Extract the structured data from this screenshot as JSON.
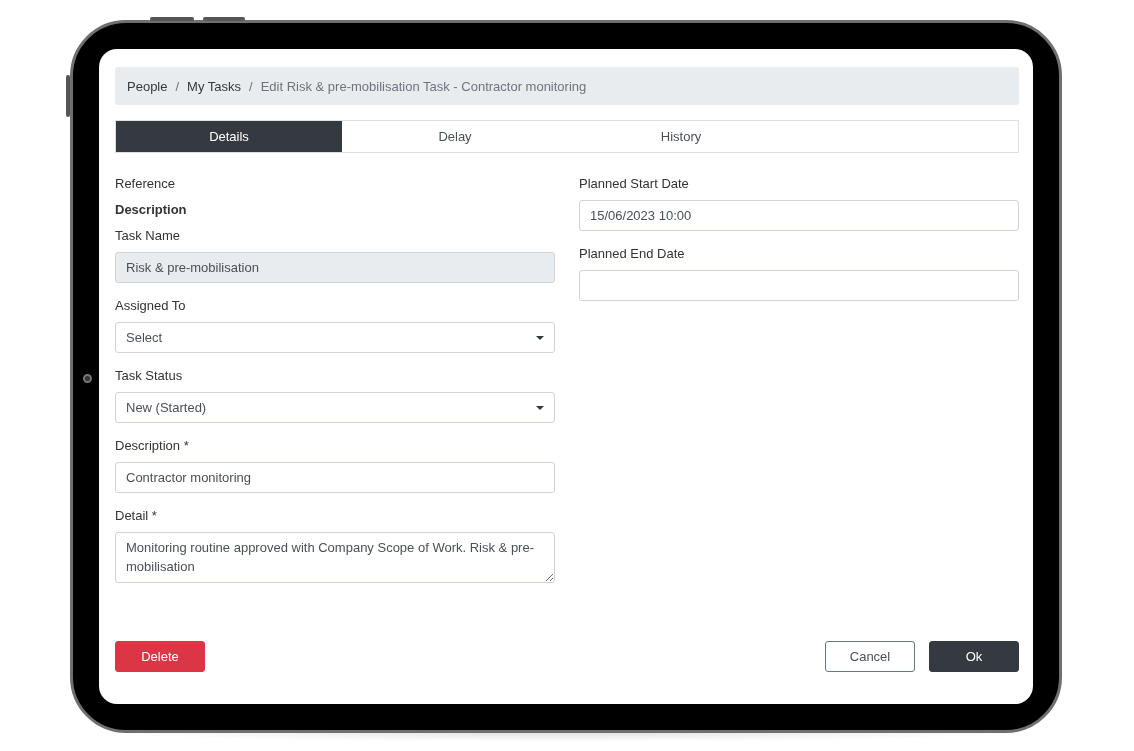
{
  "breadcrumb": [
    {
      "label": "People",
      "current": false,
      "separator": "/"
    },
    {
      "label": "My Tasks",
      "current": false,
      "separator": "/"
    },
    {
      "label": "Edit Risk & pre-mobilisation Task - Contractor monitoring",
      "current": true
    }
  ],
  "tabs": [
    {
      "label": "Details",
      "selected": true
    },
    {
      "label": "Delay",
      "selected": false
    },
    {
      "label": "History",
      "selected": false
    }
  ],
  "left_column": [
    {
      "kind": "label",
      "text": "Reference"
    },
    {
      "kind": "heading",
      "text": "Description"
    },
    {
      "kind": "input",
      "label": "Task Name",
      "value": "Risk & pre-mobilisation",
      "disabled": true
    },
    {
      "kind": "select",
      "label": "Assigned To",
      "value": "Select",
      "disabled": false
    },
    {
      "kind": "select",
      "label": "Task Status",
      "value": "New (Started)",
      "disabled": false
    },
    {
      "kind": "input",
      "label": "Description *",
      "value": "Contractor monitoring",
      "disabled": false
    },
    {
      "kind": "textarea",
      "label": "Detail *",
      "value": "Monitoring routine approved with Company Scope of Work. Risk & pre-mobilisation",
      "disabled": false
    }
  ],
  "right_column": [
    {
      "kind": "input",
      "label": "Planned Start Date",
      "value": "15/06/2023 10:00",
      "disabled": false
    },
    {
      "kind": "input",
      "label": "Planned End Date",
      "disabled": false
    }
  ],
  "buttons": [
    {
      "label": "Delete",
      "kind": "danger"
    },
    {
      "label": "Cancel",
      "kind": "outline"
    },
    {
      "label": "Ok",
      "kind": "dark"
    }
  ]
}
